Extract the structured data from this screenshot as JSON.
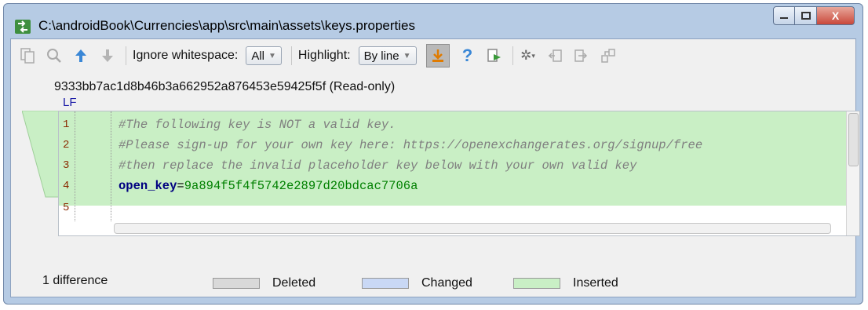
{
  "window": {
    "title": "C:\\androidBook\\Currencies\\app\\src\\main\\assets\\keys.properties",
    "close_glyph": "X"
  },
  "toolbar": {
    "ignore_whitespace_label": "Ignore whitespace:",
    "ignore_whitespace_value": "All",
    "highlight_label": "Highlight:",
    "highlight_value": "By line",
    "help_glyph": "?"
  },
  "revision": {
    "hash": "9333bb7ac1d8b46b3a662952a876453e59425f5f (Read-only)",
    "line_ending": "LF"
  },
  "editor": {
    "lines": [
      {
        "number": "1",
        "text": "#The following key is NOT a valid key."
      },
      {
        "number": "2",
        "text": "#Please sign-up for your own key here: https://openexchangerates.org/signup/free"
      },
      {
        "number": "3",
        "text": "#then replace the invalid placeholder key below with your own valid key"
      },
      {
        "number": "4",
        "key": "open_key",
        "equals": "=",
        "value": "9a894f5f4f5742e2897d20bdcac7706a"
      },
      {
        "number": "5",
        "text": ""
      }
    ]
  },
  "status": {
    "difference_count": "1 difference",
    "legend": [
      {
        "label": "Deleted",
        "color": "#d9d9d9"
      },
      {
        "label": "Changed",
        "color": "#c9d8f5"
      },
      {
        "label": "Inserted",
        "color": "#c9efc5"
      }
    ]
  },
  "colors": {
    "inserted_bg": "#c9efc5",
    "window_frame": "#b6cbe4"
  }
}
